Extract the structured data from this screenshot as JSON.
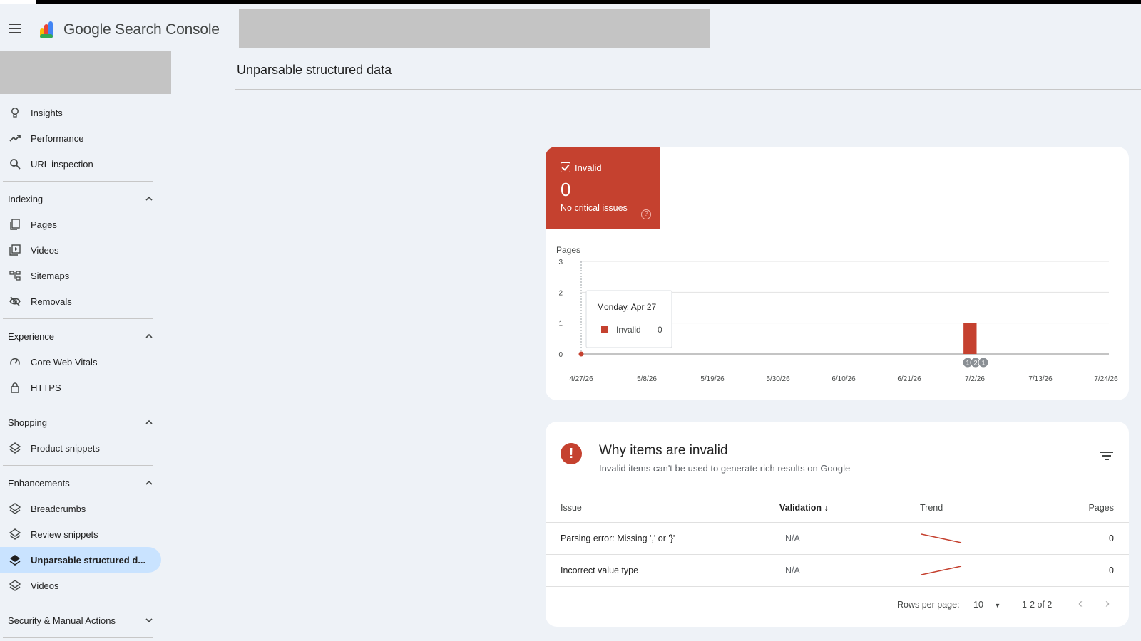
{
  "app": {
    "product_name": "Google Search Console"
  },
  "page": {
    "title": "Unparsable structured data"
  },
  "sidebar": {
    "top_items": [
      {
        "label": "Insights",
        "icon": "lightbulb-icon"
      },
      {
        "label": "Performance",
        "icon": "trending-up-icon"
      },
      {
        "label": "URL inspection",
        "icon": "search-icon"
      }
    ],
    "sections": [
      {
        "title": "Indexing",
        "expanded": true,
        "items": [
          {
            "label": "Pages",
            "icon": "pages-icon"
          },
          {
            "label": "Videos",
            "icon": "video-icon"
          },
          {
            "label": "Sitemaps",
            "icon": "sitemap-icon"
          },
          {
            "label": "Removals",
            "icon": "eye-off-icon"
          }
        ]
      },
      {
        "title": "Experience",
        "expanded": true,
        "items": [
          {
            "label": "Core Web Vitals",
            "icon": "gauge-icon"
          },
          {
            "label": "HTTPS",
            "icon": "lock-icon"
          }
        ]
      },
      {
        "title": "Shopping",
        "expanded": true,
        "items": [
          {
            "label": "Product snippets",
            "icon": "layers-icon"
          }
        ]
      },
      {
        "title": "Enhancements",
        "expanded": true,
        "items": [
          {
            "label": "Breadcrumbs",
            "icon": "layers-icon"
          },
          {
            "label": "Review snippets",
            "icon": "layers-icon"
          },
          {
            "label": "Unparsable structured d...",
            "icon": "layers-icon",
            "active": true
          },
          {
            "label": "Videos",
            "icon": "layers-icon"
          }
        ]
      },
      {
        "title": "Security & Manual Actions",
        "expanded": false,
        "items": []
      }
    ]
  },
  "summary": {
    "label": "Invalid",
    "value": "0",
    "subtitle": "No critical issues",
    "color": "#c5412f"
  },
  "chart_data": {
    "type": "bar",
    "ylabel": "Pages",
    "ylim": [
      0,
      3
    ],
    "yticks": [
      "0",
      "1",
      "2",
      "3"
    ],
    "xticks": [
      "4/27/26",
      "5/8/26",
      "5/19/26",
      "5/30/26",
      "6/10/26",
      "6/21/26",
      "7/2/26",
      "7/13/26",
      "7/24/26"
    ],
    "series": [
      {
        "color": "#c5412f",
        "points": [
          {
            "x": "7/1/26",
            "y": 1
          },
          {
            "x": "7/2/26",
            "y": 1
          }
        ]
      }
    ],
    "annotations": [
      "1",
      "2",
      "1"
    ],
    "tooltip": {
      "date": "Monday, Apr 27",
      "series": "Invalid",
      "value": "0"
    }
  },
  "issues": {
    "title": "Why items are invalid",
    "subtitle": "Invalid items can't be used to generate rich results on Google",
    "columns": {
      "issue": "Issue",
      "validation": "Validation",
      "trend": "Trend",
      "pages": "Pages"
    },
    "rows": [
      {
        "issue": "Parsing error: Missing ',' or '}'",
        "validation": "N/A",
        "trend": "down",
        "pages": "0"
      },
      {
        "issue": "Incorrect value type",
        "validation": "N/A",
        "trend": "up",
        "pages": "0"
      }
    ],
    "pager": {
      "rows_label": "Rows per page:",
      "rows_value": "10",
      "range": "1-2 of 2"
    }
  }
}
